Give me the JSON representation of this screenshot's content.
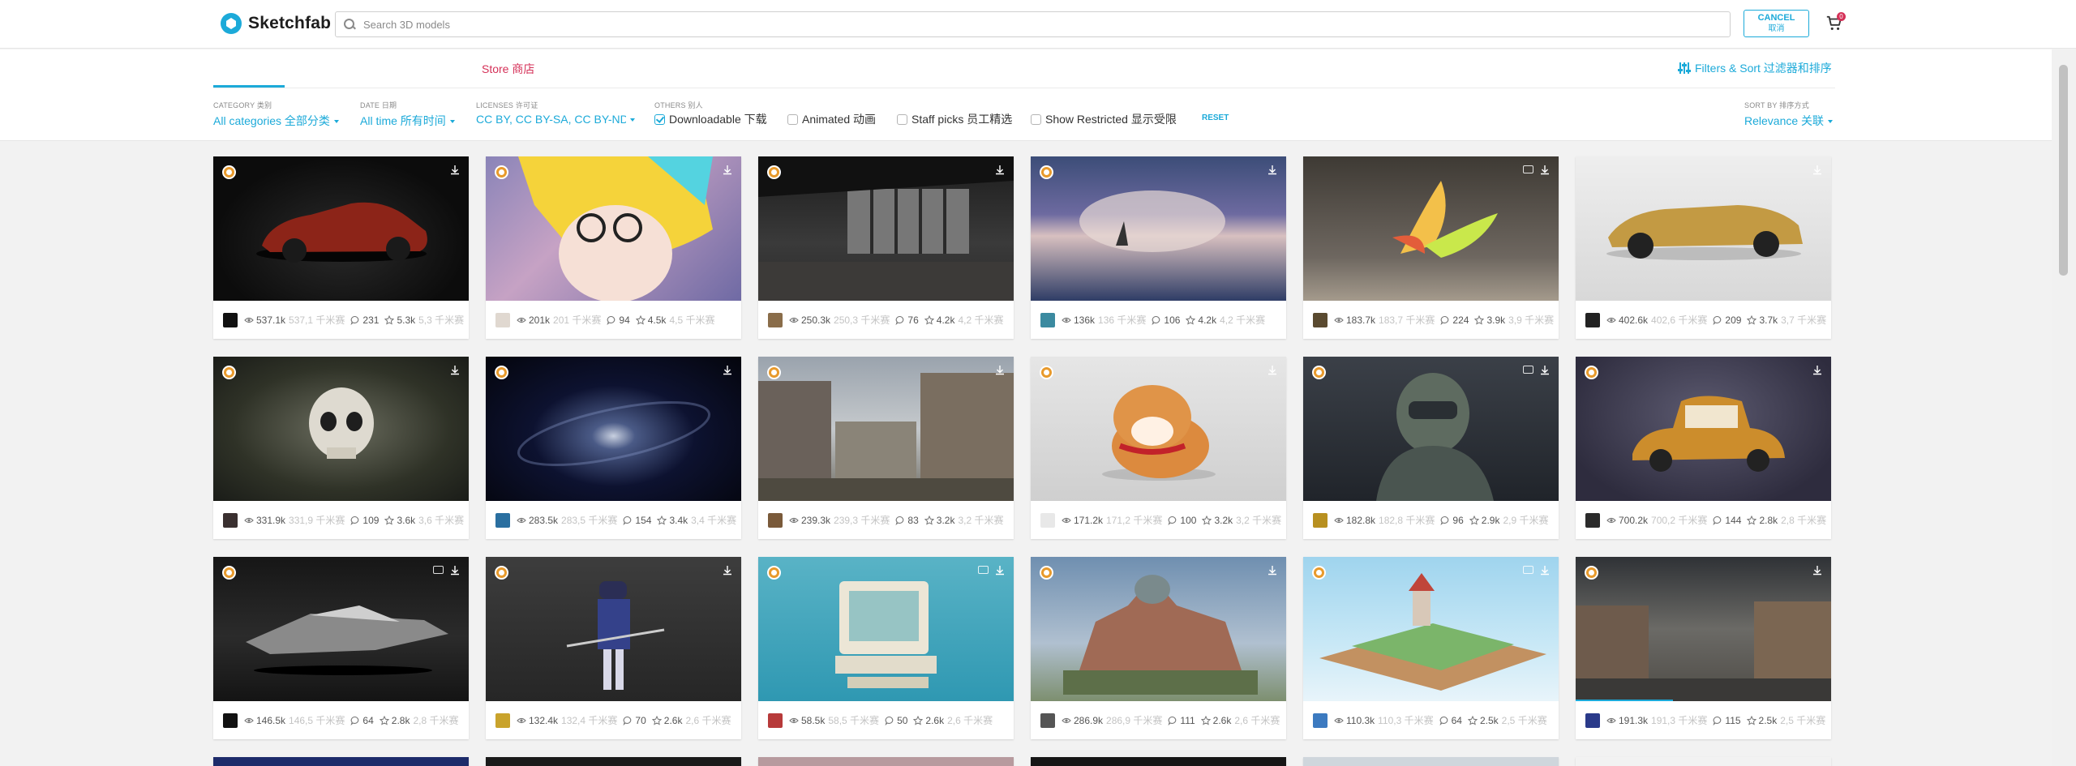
{
  "header": {
    "logo_text": "Sketchfab",
    "search_placeholder": "Search 3D models",
    "cancel_label": "CANCEL",
    "cancel_label_cn": "取消",
    "cart_count": "0"
  },
  "tabs": {
    "store_label": "Store 商店"
  },
  "filters_sort_label": "Filters & Sort 过滤器和排序",
  "filters": {
    "category": {
      "label": "CATEGORY 类别",
      "value": "All categories 全部分类"
    },
    "date": {
      "label": "DATE 日期",
      "value": "All time 所有时间"
    },
    "licenses": {
      "label": "LICENSES 许可证",
      "value": "CC BY, CC BY-SA, CC BY-ND, C"
    },
    "others": {
      "label": "OTHERS 别人"
    },
    "downloadable": {
      "label": "Downloadable 下载",
      "checked": true
    },
    "animated": {
      "label": "Animated 动画",
      "checked": false
    },
    "staff_picks": {
      "label": "Staff picks 员工精选",
      "checked": false
    },
    "show_restricted": {
      "label": "Show Restricted 显示受限",
      "checked": false
    },
    "reset_label": "RESET",
    "sort": {
      "label": "SORT BY 排序方式",
      "value": "Relevance 关联"
    }
  },
  "models": [
    {
      "views": "537.1k",
      "views_cn": "537,1 千米赛",
      "comments": "231",
      "likes": "5.3k",
      "likes_cn": "5,3 千米赛"
    },
    {
      "views": "201k",
      "views_cn": "201 千米赛",
      "comments": "94",
      "likes": "4.5k",
      "likes_cn": "4,5 千米赛"
    },
    {
      "views": "250.3k",
      "views_cn": "250,3 千米赛",
      "comments": "76",
      "likes": "4.2k",
      "likes_cn": "4,2 千米赛"
    },
    {
      "views": "136k",
      "views_cn": "136 千米赛",
      "comments": "106",
      "likes": "4.2k",
      "likes_cn": "4,2 千米赛"
    },
    {
      "views": "183.7k",
      "views_cn": "183,7 千米赛",
      "comments": "224",
      "likes": "3.9k",
      "likes_cn": "3,9 千米赛"
    },
    {
      "views": "402.6k",
      "views_cn": "402,6 千米赛",
      "comments": "209",
      "likes": "3.7k",
      "likes_cn": "3,7 千米赛"
    },
    {
      "views": "331.9k",
      "views_cn": "331,9 千米赛",
      "comments": "109",
      "likes": "3.6k",
      "likes_cn": "3,6 千米赛"
    },
    {
      "views": "283.5k",
      "views_cn": "283,5 千米赛",
      "comments": "154",
      "likes": "3.4k",
      "likes_cn": "3,4 千米赛"
    },
    {
      "views": "239.3k",
      "views_cn": "239,3 千米赛",
      "comments": "83",
      "likes": "3.2k",
      "likes_cn": "3,2 千米赛"
    },
    {
      "views": "171.2k",
      "views_cn": "171,2 千米赛",
      "comments": "100",
      "likes": "3.2k",
      "likes_cn": "3,2 千米赛"
    },
    {
      "views": "182.8k",
      "views_cn": "182,8 千米赛",
      "comments": "96",
      "likes": "2.9k",
      "likes_cn": "2,9 千米赛"
    },
    {
      "views": "700.2k",
      "views_cn": "700,2 千米赛",
      "comments": "144",
      "likes": "2.8k",
      "likes_cn": "2,8 千米赛"
    },
    {
      "views": "146.5k",
      "views_cn": "146,5 千米赛",
      "comments": "64",
      "likes": "2.8k",
      "likes_cn": "2,8 千米赛"
    },
    {
      "views": "132.4k",
      "views_cn": "132,4 千米赛",
      "comments": "70",
      "likes": "2.6k",
      "likes_cn": "2,6 千米赛"
    },
    {
      "views": "58.5k",
      "views_cn": "58,5 千米赛",
      "comments": "50",
      "likes": "2.6k",
      "likes_cn": "2,6 千米赛"
    },
    {
      "views": "286.9k",
      "views_cn": "286,9 千米赛",
      "comments": "111",
      "likes": "2.6k",
      "likes_cn": "2,6 千米赛"
    },
    {
      "views": "110.3k",
      "views_cn": "110,3 千米赛",
      "comments": "64",
      "likes": "2.5k",
      "likes_cn": "2,5 千米赛"
    },
    {
      "views": "191.3k",
      "views_cn": "191,3 千米赛",
      "comments": "115",
      "likes": "2.5k",
      "likes_cn": "2,5 千米赛"
    }
  ],
  "colors": {
    "accent": "#1caad9",
    "store": "#d53158"
  }
}
